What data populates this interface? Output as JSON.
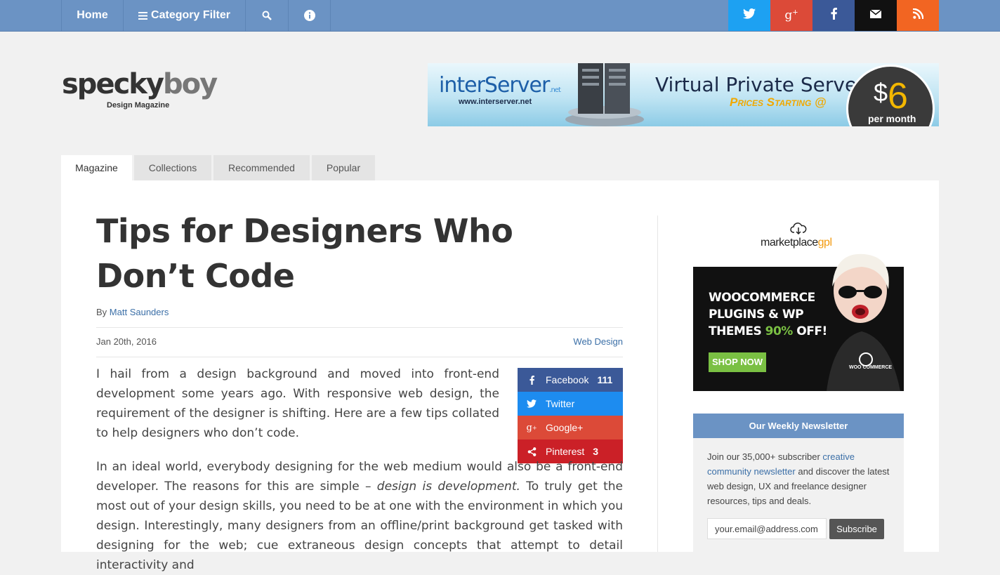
{
  "nav": {
    "home": "Home",
    "category_filter": "Category Filter",
    "search_icon": "search-icon",
    "info_icon": "info-icon",
    "social": [
      {
        "name": "twitter-icon",
        "color": "#1da1f2"
      },
      {
        "name": "google-plus-icon",
        "color": "#dc4a38"
      },
      {
        "name": "facebook-icon",
        "color": "#3b5998"
      },
      {
        "name": "email-icon",
        "color": "#111111"
      },
      {
        "name": "rss-icon",
        "color": "#f26522"
      }
    ],
    "bar_color": "#6b93c4"
  },
  "logo": {
    "word_a": "specky",
    "word_b": "boy",
    "subtitle": "Design Magazine"
  },
  "banner": {
    "brand": "interServer",
    "brand_suffix": ".net",
    "url": "www.interserver.net",
    "headline": "Virtual Private Server",
    "subline": "Prices Starting @",
    "currency": "$",
    "price": "6",
    "period": "per month"
  },
  "tabs": [
    "Magazine",
    "Collections",
    "Recommended",
    "Popular"
  ],
  "active_tab": "Magazine",
  "article": {
    "title": "Tips for Designers Who Don’t Code",
    "by_label": "By",
    "author": "Matt Saunders",
    "date": "Jan 20th, 2016",
    "category": "Web Design",
    "para1": "I hail from a design background and moved into front-end development some years ago. With responsive web design, the requirement of the designer is shifting. Here are a few tips collated to help designers who don’t code.",
    "para2_a": "In an ideal world, everybody designing for the web medium would also be a front-end developer. The reasons for this are simple –",
    "para2_em": "design is development.",
    "para2_b": "To truly get the most out of your design skills, you need to be at one with the environment in which you design. Interestingly, many designers from an offline/print background get tasked with designing for the web; cue extraneous design concepts that attempt to detail interactivity and"
  },
  "share": [
    {
      "label": "Facebook",
      "count": "111",
      "color": "#3b5998"
    },
    {
      "label": "Twitter",
      "count": "",
      "color": "#1d8cf0"
    },
    {
      "label": "Google+",
      "count": "",
      "color": "#dc4a38"
    },
    {
      "label": "Pinterest",
      "count": "3",
      "color": "#cb2027"
    }
  ],
  "sidebar_ad": {
    "brand_a": "marketplace",
    "brand_b": "gpl",
    "line1": "WOOCOMMERCE",
    "line2": "PLUGINS & WP",
    "line3_a": "THEMES",
    "line3_pct": "90%",
    "line3_b": "OFF!",
    "cta": "SHOP NOW",
    "woo": "WOO COMMERCE"
  },
  "newsletter": {
    "heading": "Our Weekly Newsletter",
    "text_a": "Join our 35,000+ subscriber",
    "link": "creative community newsletter",
    "text_b": "and discover the latest web design, UX and freelance designer resources, tips and deals.",
    "email_value": "your.email@address.com",
    "button": "Subscribe"
  }
}
